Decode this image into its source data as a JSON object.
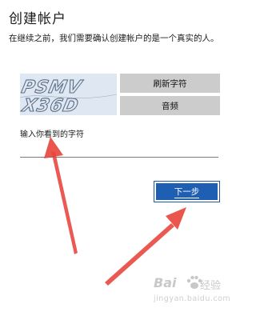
{
  "page": {
    "title": "创建帐户",
    "description": "在继续之前，我们需要确认创建帐户的是一个真实的人。"
  },
  "captcha": {
    "text": "PSMV X36D",
    "refresh_label": "刷新字符",
    "audio_label": "音频"
  },
  "input": {
    "label": "输入你看到的字符",
    "value": ""
  },
  "actions": {
    "next_label": "下一步"
  },
  "watermark": {
    "logo": "Bai",
    "brand": "经验",
    "url": "jingyan.baidu.com"
  },
  "colors": {
    "primary": "#1f5fb3",
    "button_gray": "#cccccc",
    "annotation_arrow": "#e8433a"
  }
}
